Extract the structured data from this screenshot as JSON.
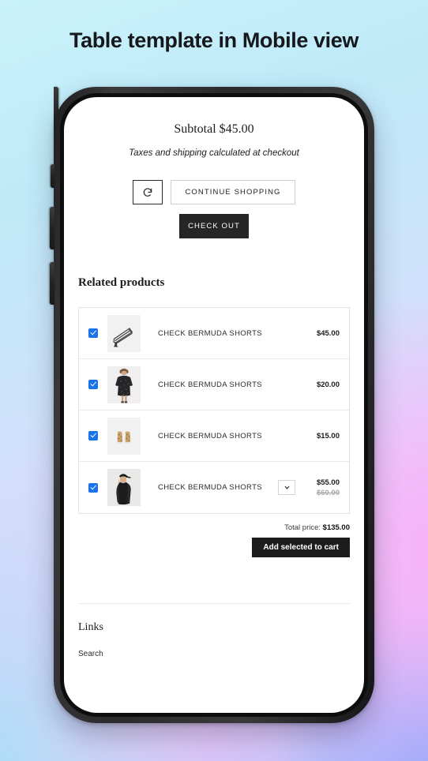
{
  "page": {
    "title": "Table template in Mobile view",
    "background_colors": {
      "top_left": "#c9f2fb",
      "bottom_right": "#93aaf9",
      "accent_pink": "#f2c9f6"
    }
  },
  "phone": {
    "frame_color": "#2b2b2d",
    "buttons": {
      "silent_switch": "silent-switch",
      "volume_up": "volume-up-button",
      "volume_down": "volume-down-button",
      "power": "power-button"
    }
  },
  "cart": {
    "subtotal_label": "Subtotal $45.00",
    "tax_note": "Taxes and shipping calculated at checkout",
    "refresh_icon": "refresh-icon",
    "continue_label": "CONTINUE SHOPPING",
    "checkout_label": "CHECK OUT"
  },
  "related": {
    "heading": "Related products",
    "checkbox_color": "#1a73e8",
    "rows": [
      {
        "checked": true,
        "thumb": "strappy-heeled-sandal-thumbnail",
        "title": "CHECK BERMUDA SHORTS",
        "price": "$45.00",
        "compare_at": "",
        "has_variant_select": false
      },
      {
        "checked": true,
        "thumb": "black-floral-dress-model-thumbnail",
        "title": "CHECK BERMUDA SHORTS",
        "price": "$20.00",
        "compare_at": "",
        "has_variant_select": false
      },
      {
        "checked": true,
        "thumb": "tan-leopard-sneakers-thumbnail",
        "title": "CHECK BERMUDA SHORTS",
        "price": "$15.00",
        "compare_at": "",
        "has_variant_select": false
      },
      {
        "checked": true,
        "thumb": "black-jacket-cap-model-thumbnail",
        "title": "CHECK BERMUDA SHORTS",
        "price": "$55.00",
        "compare_at": "$60.00",
        "has_variant_select": true
      }
    ],
    "total_label": "Total price:",
    "total_value": "$135.00",
    "add_button_label": "Add selected to cart"
  },
  "footer": {
    "heading": "Links",
    "links": [
      {
        "label": "Search"
      }
    ]
  }
}
